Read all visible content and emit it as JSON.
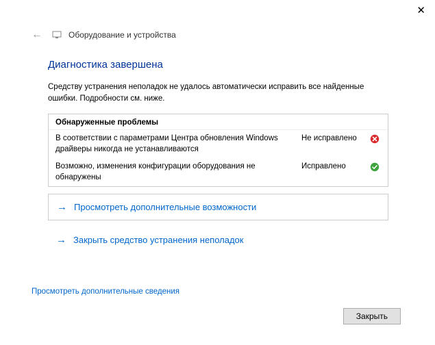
{
  "titlebar": {
    "close_glyph": "✕"
  },
  "header": {
    "back_glyph": "←",
    "title": "Оборудование и устройства"
  },
  "main": {
    "heading": "Диагностика завершена",
    "subtext": "Средству устранения неполадок не удалось автоматически исправить все найденные ошибки. Подробности см. ниже.",
    "problems_header": "Обнаруженные проблемы",
    "problems": [
      {
        "text": "В соответствии с параметрами Центра обновления Windows драйверы никогда не устанавливаются",
        "status": "Не исправлено",
        "icon": "error"
      },
      {
        "text": "Возможно, изменения конфигурации оборудования не обнаружены",
        "status": "Исправлено",
        "icon": "ok"
      }
    ],
    "action_primary": "Просмотреть дополнительные возможности",
    "action_secondary": "Закрыть средство устранения неполадок",
    "more_info": "Просмотреть дополнительные сведения"
  },
  "footer": {
    "close_label": "Закрыть"
  }
}
